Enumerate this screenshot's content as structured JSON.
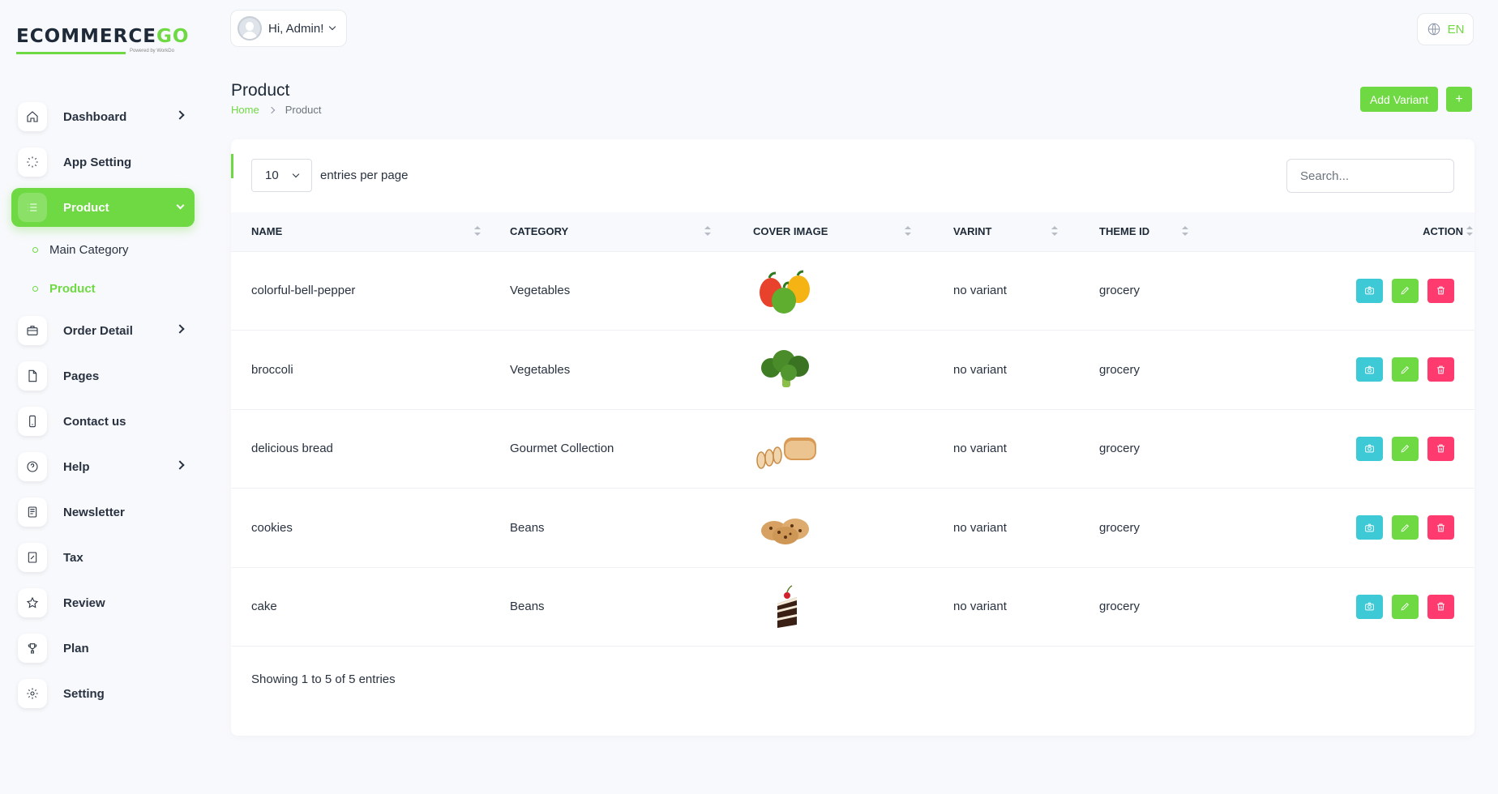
{
  "brand": {
    "logo_main": "ECOMMERCE",
    "logo_accent": "GO",
    "logo_sub": "Powered by WorkDo"
  },
  "header": {
    "greeting": "Hi, Admin!",
    "language": "EN"
  },
  "sidebar": {
    "items": [
      {
        "label": "Dashboard",
        "icon": "home-icon",
        "has_arrow": true
      },
      {
        "label": "App Setting",
        "icon": "loader-icon",
        "has_arrow": false
      },
      {
        "label": "Product",
        "icon": "list-icon",
        "has_arrow": true,
        "active": true
      },
      {
        "label": "Order Detail",
        "icon": "briefcase-icon",
        "has_arrow": true
      },
      {
        "label": "Pages",
        "icon": "file-icon",
        "has_arrow": false
      },
      {
        "label": "Contact us",
        "icon": "phone-icon",
        "has_arrow": false
      },
      {
        "label": "Help",
        "icon": "help-circle-icon",
        "has_arrow": true
      },
      {
        "label": "Newsletter",
        "icon": "news-icon",
        "has_arrow": false
      },
      {
        "label": "Tax",
        "icon": "receipt-icon",
        "has_arrow": false
      },
      {
        "label": "Review",
        "icon": "star-icon",
        "has_arrow": false
      },
      {
        "label": "Plan",
        "icon": "trophy-icon",
        "has_arrow": false
      },
      {
        "label": "Setting",
        "icon": "gear-icon",
        "has_arrow": false
      }
    ],
    "product_sub": [
      {
        "label": "Main Category",
        "active": false
      },
      {
        "label": "Product",
        "active": true
      }
    ]
  },
  "page": {
    "title": "Product",
    "breadcrumb": {
      "home": "Home",
      "current": "Product"
    },
    "add_variant_label": "Add Variant",
    "add_label": "+"
  },
  "table_controls": {
    "per_page_value": "10",
    "per_page_label": "entries per page",
    "search_placeholder": "Search..."
  },
  "table": {
    "columns": [
      "Name",
      "Category",
      "Cover Image",
      "Varint",
      "Theme ID",
      "Action"
    ],
    "rows": [
      {
        "name": "colorful-bell-pepper",
        "category": "Vegetables",
        "image": "bell-pepper-image",
        "variant": "no variant",
        "theme": "grocery"
      },
      {
        "name": "broccoli",
        "category": "Vegetables",
        "image": "broccoli-image",
        "variant": "no variant",
        "theme": "grocery"
      },
      {
        "name": "delicious bread",
        "category": "Gourmet Collection",
        "image": "bread-image",
        "variant": "no variant",
        "theme": "grocery"
      },
      {
        "name": "cookies",
        "category": "Beans",
        "image": "cookies-image",
        "variant": "no variant",
        "theme": "grocery"
      },
      {
        "name": "cake",
        "category": "Beans",
        "image": "cake-image",
        "variant": "no variant",
        "theme": "grocery"
      }
    ],
    "footer": "Showing 1 to 5 of 5 entries"
  },
  "colors": {
    "accent": "#6fd943",
    "info": "#3ec9d6",
    "danger": "#ff3a6e",
    "background": "#f8f9fc"
  }
}
